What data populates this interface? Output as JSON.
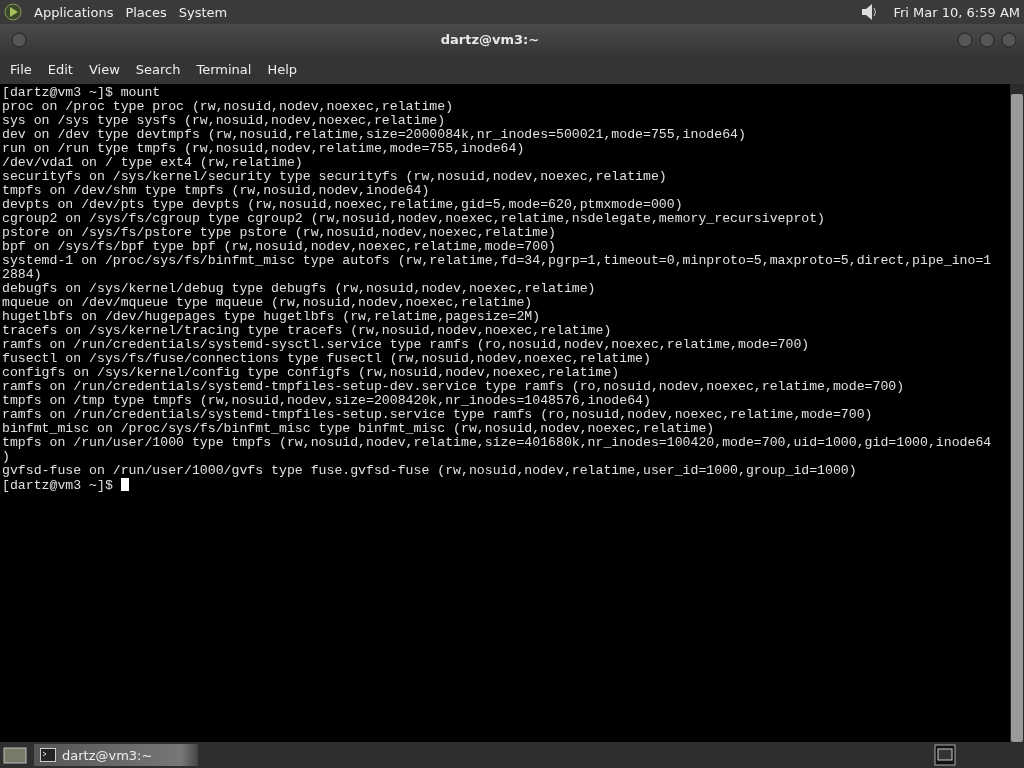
{
  "top_panel": {
    "menus": [
      "Applications",
      "Places",
      "System"
    ],
    "clock": "Fri Mar 10,  6:59 AM"
  },
  "window": {
    "title": "dartz@vm3:~"
  },
  "menu_bar": [
    "File",
    "Edit",
    "View",
    "Search",
    "Terminal",
    "Help"
  ],
  "terminal": {
    "lines": [
      "[dartz@vm3 ~]$ mount",
      "proc on /proc type proc (rw,nosuid,nodev,noexec,relatime)",
      "sys on /sys type sysfs (rw,nosuid,nodev,noexec,relatime)",
      "dev on /dev type devtmpfs (rw,nosuid,relatime,size=2000084k,nr_inodes=500021,mode=755,inode64)",
      "run on /run type tmpfs (rw,nosuid,nodev,relatime,mode=755,inode64)",
      "/dev/vda1 on / type ext4 (rw,relatime)",
      "securityfs on /sys/kernel/security type securityfs (rw,nosuid,nodev,noexec,relatime)",
      "tmpfs on /dev/shm type tmpfs (rw,nosuid,nodev,inode64)",
      "devpts on /dev/pts type devpts (rw,nosuid,noexec,relatime,gid=5,mode=620,ptmxmode=000)",
      "cgroup2 on /sys/fs/cgroup type cgroup2 (rw,nosuid,nodev,noexec,relatime,nsdelegate,memory_recursiveprot)",
      "pstore on /sys/fs/pstore type pstore (rw,nosuid,nodev,noexec,relatime)",
      "bpf on /sys/fs/bpf type bpf (rw,nosuid,nodev,noexec,relatime,mode=700)",
      "systemd-1 on /proc/sys/fs/binfmt_misc type autofs (rw,relatime,fd=34,pgrp=1,timeout=0,minproto=5,maxproto=5,direct,pipe_ino=1",
      "2884)",
      "debugfs on /sys/kernel/debug type debugfs (rw,nosuid,nodev,noexec,relatime)",
      "mqueue on /dev/mqueue type mqueue (rw,nosuid,nodev,noexec,relatime)",
      "hugetlbfs on /dev/hugepages type hugetlbfs (rw,relatime,pagesize=2M)",
      "tracefs on /sys/kernel/tracing type tracefs (rw,nosuid,nodev,noexec,relatime)",
      "ramfs on /run/credentials/systemd-sysctl.service type ramfs (ro,nosuid,nodev,noexec,relatime,mode=700)",
      "fusectl on /sys/fs/fuse/connections type fusectl (rw,nosuid,nodev,noexec,relatime)",
      "configfs on /sys/kernel/config type configfs (rw,nosuid,nodev,noexec,relatime)",
      "ramfs on /run/credentials/systemd-tmpfiles-setup-dev.service type ramfs (ro,nosuid,nodev,noexec,relatime,mode=700)",
      "tmpfs on /tmp type tmpfs (rw,nosuid,nodev,size=2008420k,nr_inodes=1048576,inode64)",
      "ramfs on /run/credentials/systemd-tmpfiles-setup.service type ramfs (ro,nosuid,nodev,noexec,relatime,mode=700)",
      "binfmt_misc on /proc/sys/fs/binfmt_misc type binfmt_misc (rw,nosuid,nodev,noexec,relatime)",
      "tmpfs on /run/user/1000 type tmpfs (rw,nosuid,nodev,relatime,size=401680k,nr_inodes=100420,mode=700,uid=1000,gid=1000,inode64",
      ")",
      "gvfsd-fuse on /run/user/1000/gvfs type fuse.gvfsd-fuse (rw,nosuid,nodev,relatime,user_id=1000,group_id=1000)"
    ],
    "prompt": "[dartz@vm3 ~]$"
  },
  "taskbar": {
    "tasks": [
      {
        "label": "dartz@vm3:~",
        "selected": true
      }
    ]
  }
}
